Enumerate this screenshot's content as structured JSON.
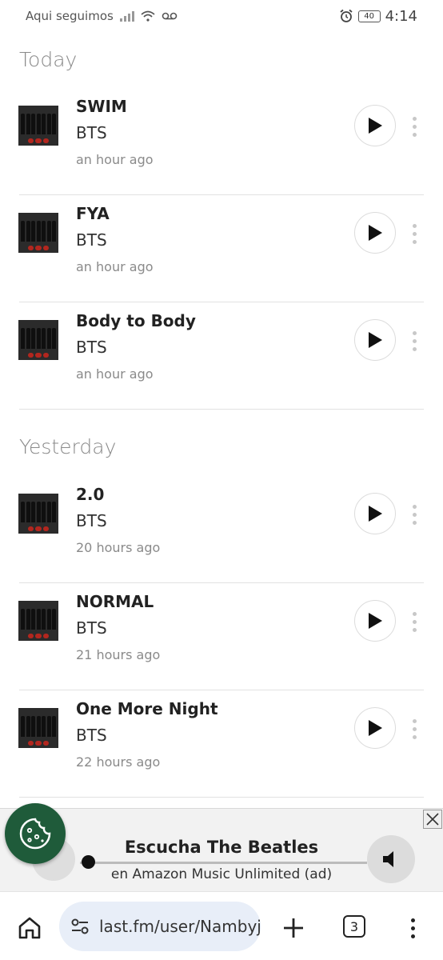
{
  "status_bar": {
    "carrier": "Aqui seguimos",
    "battery": "40",
    "time": "4:14"
  },
  "sections": [
    {
      "title": "Today",
      "tracks": [
        {
          "title": "SWIM",
          "artist": "BTS",
          "time": "an hour ago"
        },
        {
          "title": "FYA",
          "artist": "BTS",
          "time": "an hour ago"
        },
        {
          "title": "Body to Body",
          "artist": "BTS",
          "time": "an hour ago"
        }
      ]
    },
    {
      "title": "Yesterday",
      "tracks": [
        {
          "title": "2.0",
          "artist": "BTS",
          "time": "20 hours ago"
        },
        {
          "title": "NORMAL",
          "artist": "BTS",
          "time": "21 hours ago"
        },
        {
          "title": "One More Night",
          "artist": "BTS",
          "time": "22 hours ago"
        }
      ]
    }
  ],
  "ad": {
    "title": "Escucha The Beatles",
    "subtitle": "en Amazon Music Unlimited (ad)"
  },
  "browser": {
    "url": "last.fm/user/Nambyjе",
    "tab_count": "3"
  },
  "icons": {
    "home": "home-icon",
    "site_settings": "tune-icon",
    "new_tab": "plus-icon",
    "menu": "more-vert-icon",
    "play": "play-icon",
    "cookie": "cookie-icon",
    "speaker": "speaker-icon"
  },
  "colors": {
    "cookie_button": "#1f5b3a",
    "url_pill": "#e8eef8",
    "section_title": "#8a8a8a"
  }
}
